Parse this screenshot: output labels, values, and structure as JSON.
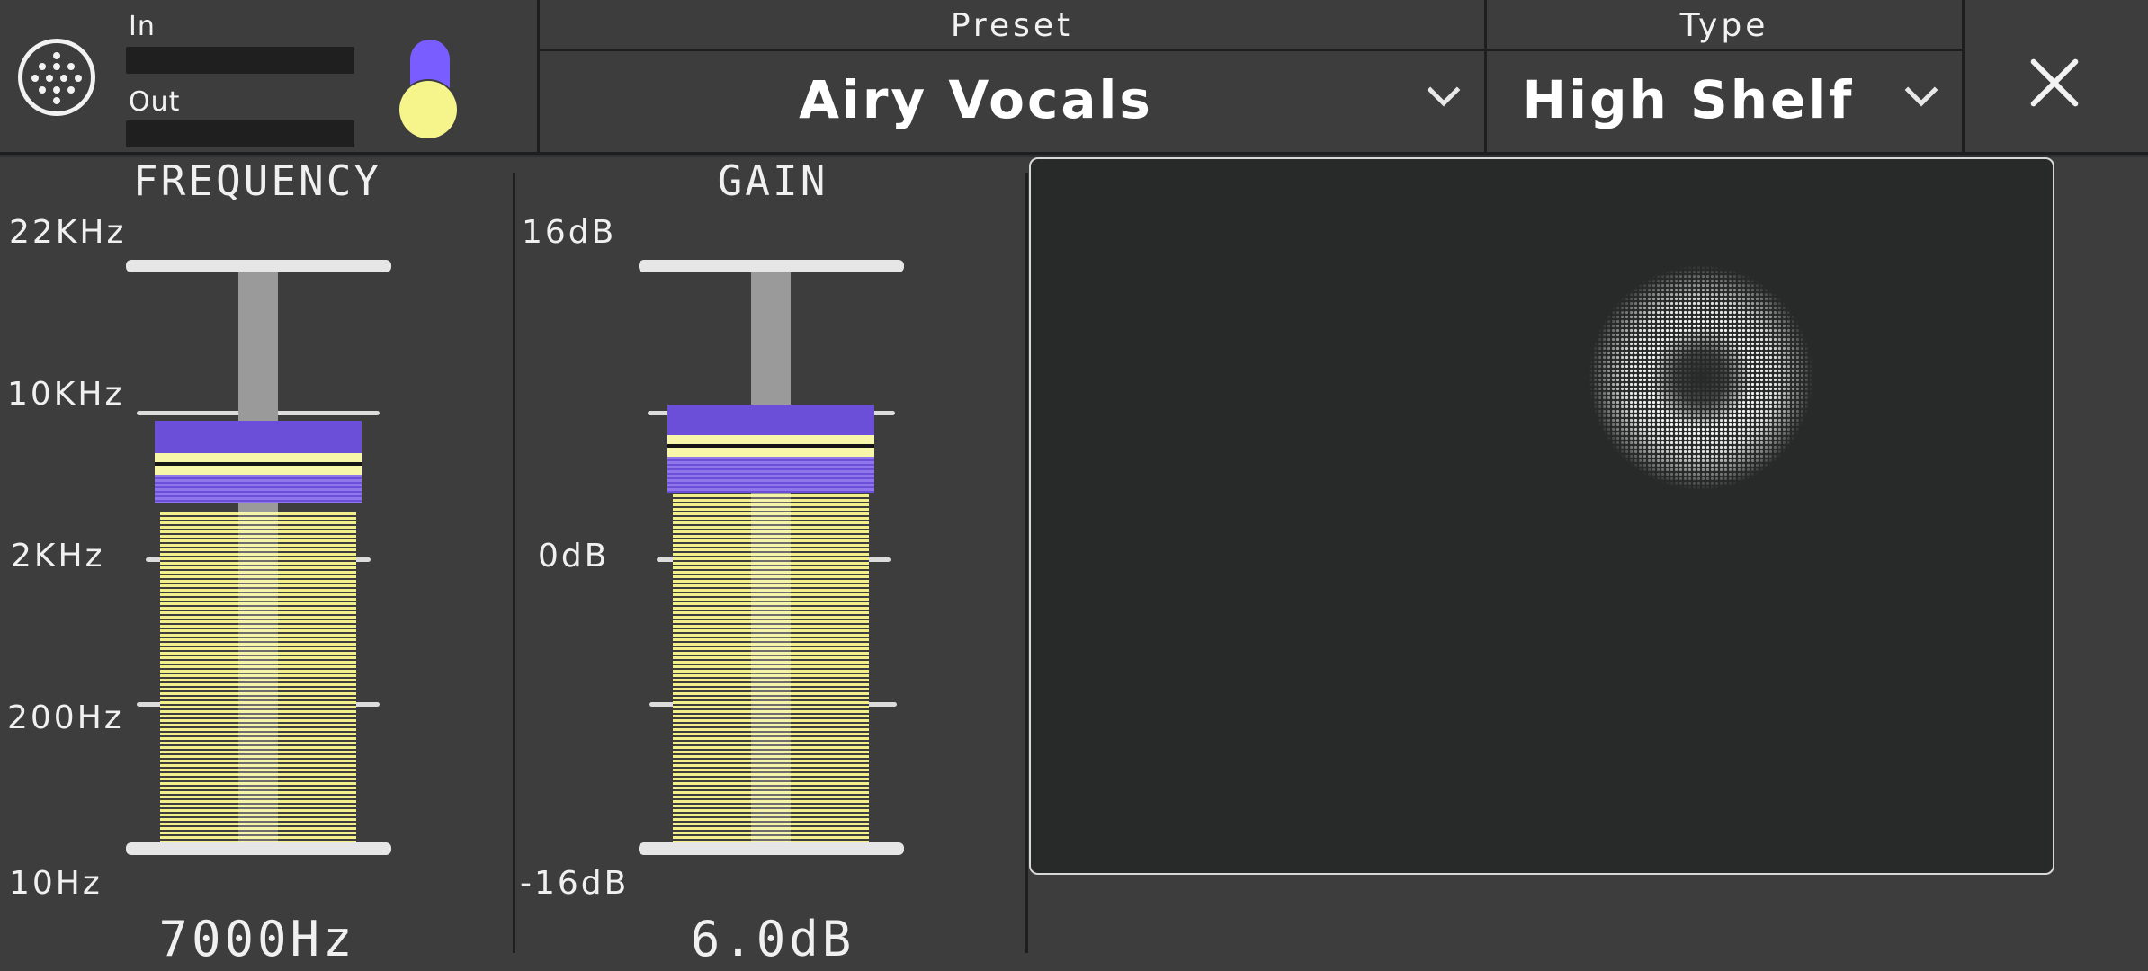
{
  "header": {
    "meters": {
      "in_label": "In",
      "out_label": "Out"
    },
    "preset": {
      "title": "Preset",
      "value": "Airy Vocals"
    },
    "type": {
      "title": "Type",
      "value": "High Shelf"
    }
  },
  "icons": {
    "logo": "dotted-circle-logo-icon",
    "bypass": "toggle-switch",
    "dropdown": "chevron-down-icon",
    "close": "close-icon"
  },
  "frequency": {
    "title": "FREQUENCY",
    "scale": [
      "22KHz",
      "10KHz",
      "2KHz",
      "200Hz",
      "10Hz"
    ],
    "readout": "7000Hz",
    "value_hz": 7000
  },
  "gain": {
    "title": "GAIN",
    "scale": [
      "16dB",
      "0dB",
      "-16dB"
    ],
    "readout": "6.0dB",
    "value_db": 6.0
  },
  "colors": {
    "accent_purple": "#7a5dff",
    "accent_yellow": "#f6f58c",
    "panel": "#3d3d3d",
    "pad": "#282929"
  }
}
